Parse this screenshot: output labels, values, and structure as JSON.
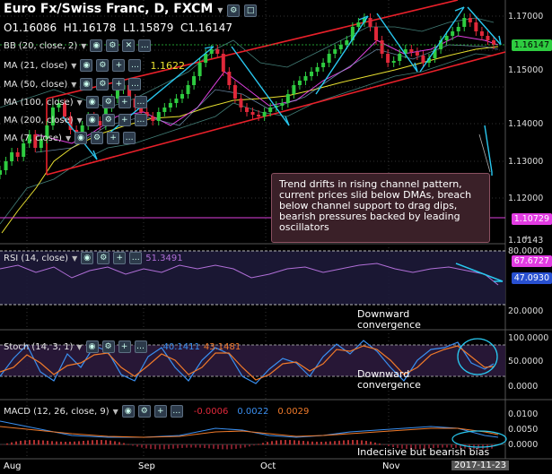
{
  "header": {
    "title": "Euro Fx/Swiss Franc, D, FXCM",
    "o_label": "O",
    "o_value": "1.16086",
    "h_label": "H",
    "h_value": "1.16178",
    "l_label": "L",
    "l_value": "1.15879",
    "c_label": "C",
    "c_value": "1.16147"
  },
  "indicators": {
    "bb": "BB (20, close, 2)",
    "ma21": "MA (21, close)",
    "ma21_value": "1.1622",
    "ma50": "MA (50, close)",
    "ma100": "MA (100, close)",
    "ma200": "MA (200, close)",
    "ma7": "MA (7, close)"
  },
  "annotation": {
    "text": "Trend drifts in rising channel pattern, current prices slid below DMAs, breach below channel support to drag dips, bearish pressures backed by leading oscillators"
  },
  "price_axis": {
    "ticks": [
      "1.17000",
      "1.16000",
      "1.15000",
      "1.14000",
      "1.13000",
      "1.12000",
      "1.11000",
      "1.10143"
    ],
    "current": "1.16147",
    "current_color": "#2ecc40",
    "low_marker": "1.10729",
    "low_marker_color": "#e23be2"
  },
  "rsi": {
    "label": "RSI (14, close)",
    "value": "51.3491",
    "ticks": [
      "80.0000",
      "20.0000"
    ],
    "badge_upper": "67.6727",
    "badge_lower": "47.0930",
    "annotation": "Downward\nconvergence"
  },
  "stoch": {
    "label": "Stoch (14, 3, 1)",
    "k": "40.1411",
    "d": "43.1481",
    "ticks": [
      "100.0000",
      "50.0000",
      "0.0000"
    ],
    "annotation": "Downward\nconvergence"
  },
  "macd": {
    "label": "MACD (12, 26, close, 9)",
    "hist": "-0.0006",
    "macd": "0.0022",
    "signal": "0.0029",
    "ticks": [
      "0.0100",
      "0.0050",
      "0.0000"
    ],
    "annotation": "Indecisive but bearish bias"
  },
  "time_axis": {
    "labels": [
      "Aug",
      "Sep",
      "Oct",
      "Nov"
    ],
    "current_date": "2017-11-23"
  },
  "colors": {
    "up": "#2ecc40",
    "down": "#e0283a",
    "channel": "#e8202a",
    "arrow": "#29c8f0",
    "ma_yellow": "#e8e030",
    "ma_magenta": "#e040e0"
  }
}
